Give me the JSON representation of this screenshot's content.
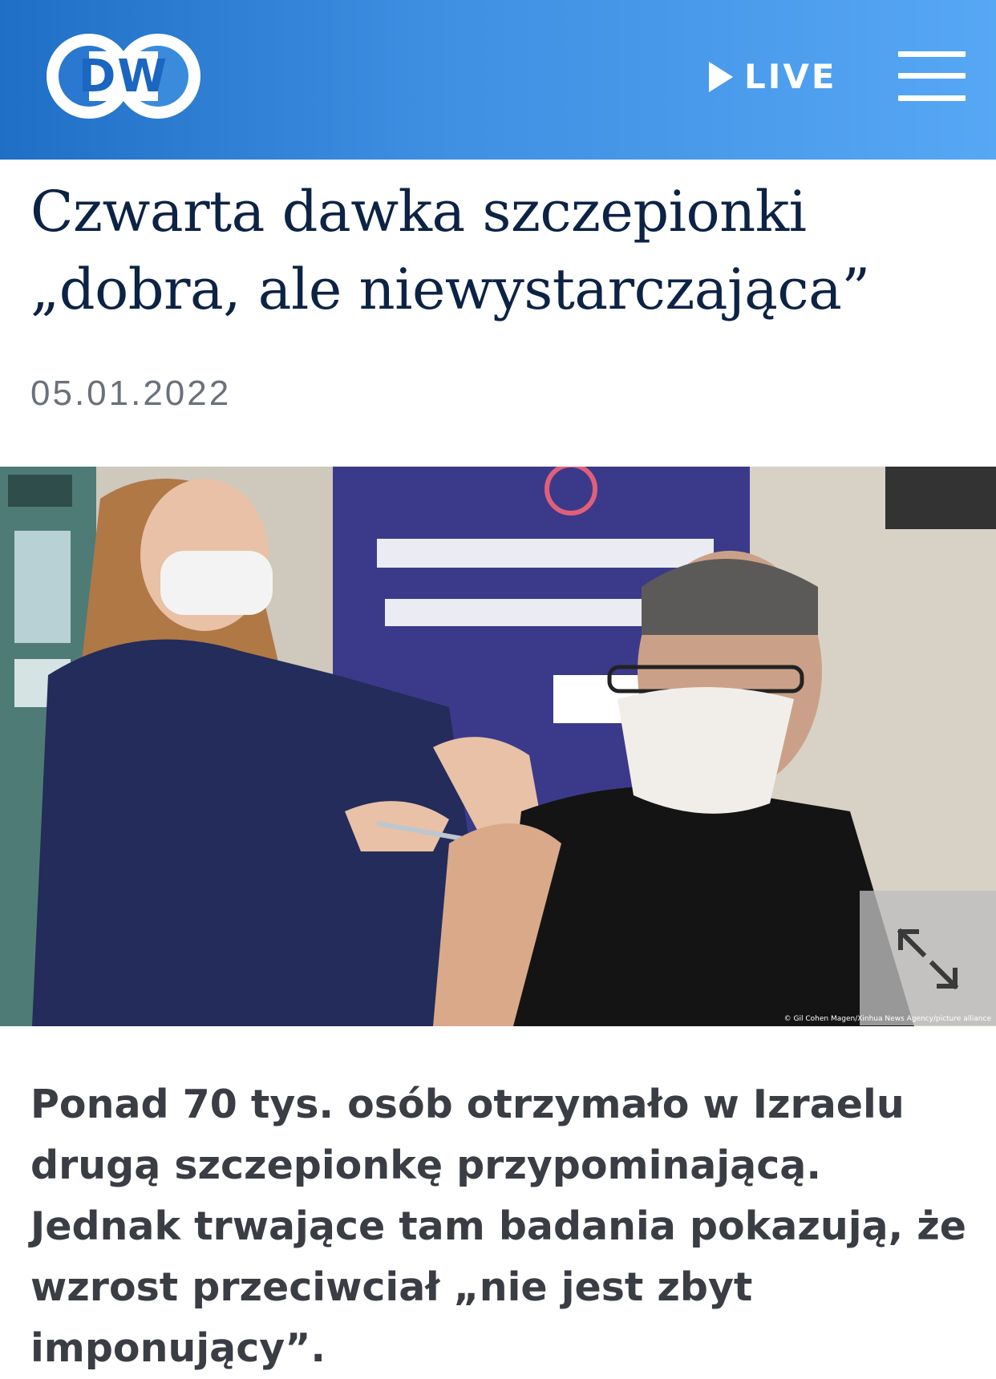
{
  "header": {
    "logo_text": "DW",
    "live_label": "LIVE",
    "colors": {
      "bar_start": "#1f6fc6",
      "bar_end": "#56a7f4",
      "foreground": "#ffffff"
    },
    "icons": {
      "live": "play-icon",
      "menu": "hamburger-menu-icon",
      "photo": "expand-icon"
    }
  },
  "article": {
    "headline_line1": "Czwarta dawka szczepionki",
    "headline_line2": "„dobra, ale niewystarczająca”",
    "date": "05.01.2022",
    "photo_credit": "© Gil Cohen Magen/Xinhua News Agency/picture alliance",
    "lead": "Ponad 70 tys. osób otrzymało w Izraelu drugą szczepionkę przypominającą. Jednak trwające tam badania pokazują, że wzrost przeciwciał „nie jest zbyt imponujący”."
  },
  "colors": {
    "headline": "#0c2345",
    "date": "#6b7079",
    "lead": "#3a3d44"
  }
}
